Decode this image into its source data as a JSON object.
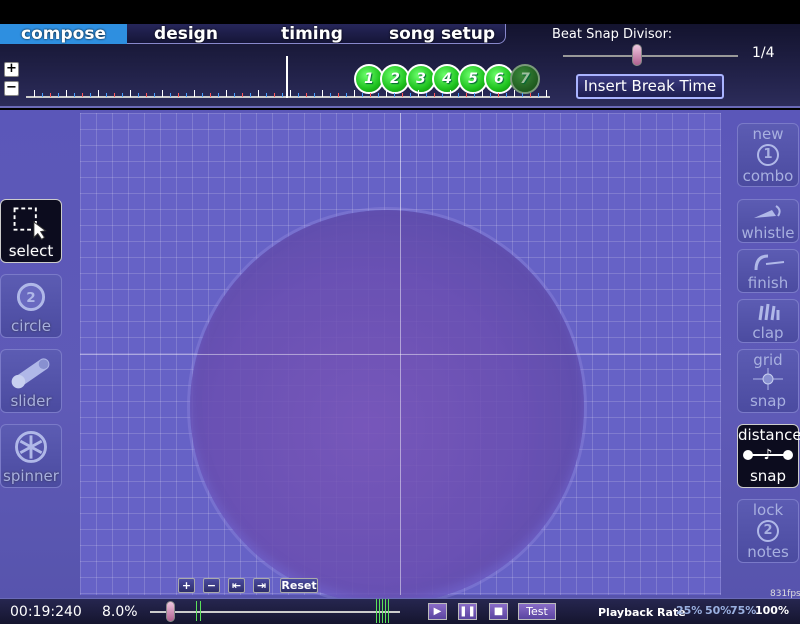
{
  "tabs": [
    {
      "label": "compose",
      "active": true
    },
    {
      "label": "design",
      "active": false
    },
    {
      "label": "timing",
      "active": false
    },
    {
      "label": "song setup",
      "active": false
    }
  ],
  "timeline": {
    "zoom_in": "+",
    "zoom_out": "−",
    "hit_objects": [
      "1",
      "2",
      "3",
      "4",
      "5",
      "6",
      "7"
    ]
  },
  "beat_snap": {
    "label": "Beat Snap Divisor:",
    "value": "1/4",
    "value_fraction": 0.45
  },
  "insert_break_label": "Insert Break Time",
  "left_tools": [
    {
      "label": "select",
      "icon": "select-icon",
      "active": true
    },
    {
      "label": "circle",
      "icon": "circle-icon",
      "active": false
    },
    {
      "label": "slider",
      "icon": "slider-icon",
      "active": false
    },
    {
      "label": "spinner",
      "icon": "spinner-icon",
      "active": false
    }
  ],
  "right_tools": {
    "new_combo": {
      "line1": "new",
      "line2": "combo",
      "icon_text": "1"
    },
    "whistle": "whistle",
    "finish": "finish",
    "clap": "clap",
    "grid_snap": {
      "line1": "grid",
      "line2": "snap"
    },
    "distance_snap": {
      "line1": "distance",
      "line2": "snap"
    },
    "lock_notes": {
      "line1": "lock",
      "line2": "notes",
      "icon_text": "2"
    }
  },
  "playfield_nav": {
    "zoom_in": "+",
    "zoom_out": "−",
    "prev": "⇤",
    "next": "⇥",
    "reset": "Reset"
  },
  "fps": "831fps",
  "bottom": {
    "time": "00:19:240",
    "progress": "8.0%",
    "progress_fraction": 0.08,
    "play": "▶",
    "pause": "❚❚",
    "stop": "■",
    "test": "Test",
    "playback_rate_label": "Playback Rate",
    "rates": [
      "25%",
      "50%",
      "75%",
      "100%"
    ]
  },
  "colors": {
    "accent_tab": "#2e8fe0",
    "hit_circle": "#1ec21e",
    "background": "#5b57b9"
  }
}
